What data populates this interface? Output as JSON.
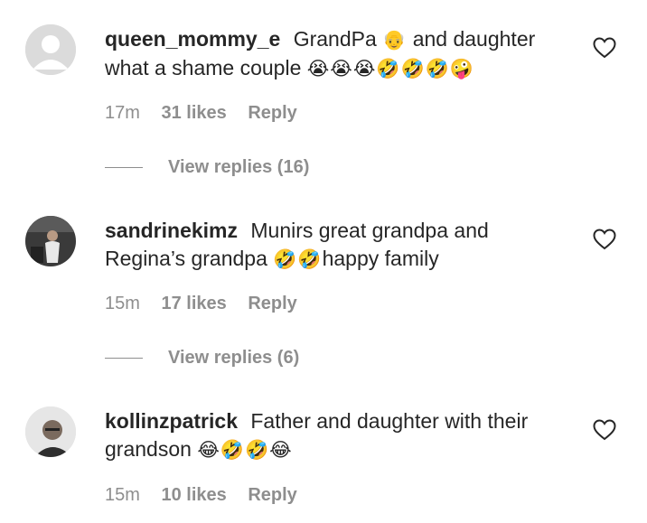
{
  "comments": [
    {
      "username": "queen_mommy_e",
      "text_a": "GrandPa",
      "emoji_a": "👴",
      "text_b": "and daughter what a shame couple",
      "emoji_b": "😭😭😭🤣🤣🤣🤪",
      "time": "17m",
      "likes": "31 likes",
      "reply": "Reply",
      "view_replies": "View replies (16)"
    },
    {
      "username": "sandrinekimz",
      "text_a": "Munirs great grandpa and Regina’s grandpa",
      "emoji_a": "🤣🤣",
      "text_b": "happy family",
      "emoji_b": "",
      "time": "15m",
      "likes": "17 likes",
      "reply": "Reply",
      "view_replies": "View replies (6)"
    },
    {
      "username": "kollinzpatrick",
      "text_a": "Father and daughter with their grandson",
      "emoji_a": "😂🤣🤣😂",
      "text_b": "",
      "emoji_b": "",
      "time": "15m",
      "likes": "10 likes",
      "reply": "Reply"
    }
  ],
  "icons": {
    "like": "heart-outline-icon",
    "default_avatar": "default-avatar-icon"
  },
  "colors": {
    "text": "#262626",
    "muted": "#8e8e8e",
    "background": "#ffffff"
  }
}
